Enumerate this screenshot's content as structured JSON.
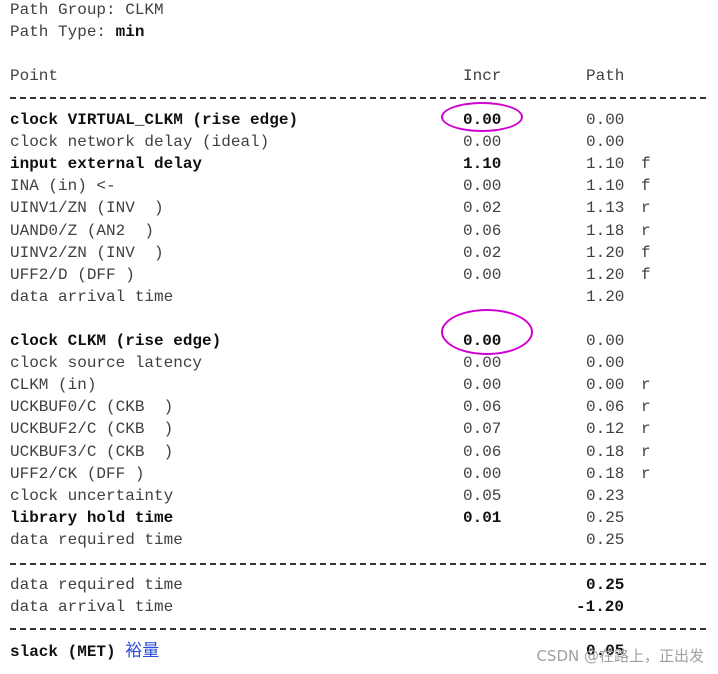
{
  "header": {
    "path_group": "Path Group: CLKM",
    "path_type_label": "Path Type: ",
    "path_type_value": "min"
  },
  "columns": {
    "point": "Point",
    "incr": "Incr",
    "path": "Path"
  },
  "launch_rows": [
    {
      "point": "clock VIRTUAL_CLKM (rise edge)",
      "incr": "0.00",
      "path": "0.00",
      "edge": "",
      "bold": true
    },
    {
      "point": "clock network delay (ideal)",
      "incr": "0.00",
      "path": "0.00",
      "edge": "",
      "bold": false
    },
    {
      "point": "input external delay",
      "incr": "1.10",
      "path": "1.10",
      "edge": "f",
      "bold": true
    },
    {
      "point": "INA (in) <-",
      "incr": "0.00",
      "path": "1.10",
      "edge": "f",
      "bold": false
    },
    {
      "point": "UINV1/ZN (INV  )",
      "incr": "0.02",
      "path": "1.13",
      "edge": "r",
      "bold": false
    },
    {
      "point": "UAND0/Z (AN2  )",
      "incr": "0.06",
      "path": "1.18",
      "edge": "r",
      "bold": false
    },
    {
      "point": "UINV2/ZN (INV  )",
      "incr": "0.02",
      "path": "1.20",
      "edge": "f",
      "bold": false
    },
    {
      "point": "UFF2/D (DFF )",
      "incr": "0.00",
      "path": "1.20",
      "edge": "f",
      "bold": false
    },
    {
      "point": "data arrival time",
      "incr": "",
      "path": "1.20",
      "edge": "",
      "bold": false
    }
  ],
  "capture_rows": [
    {
      "point": "clock CLKM (rise edge)",
      "incr": "0.00",
      "path": "0.00",
      "edge": "",
      "bold": true
    },
    {
      "point": "clock source latency",
      "incr": "0.00",
      "path": "0.00",
      "edge": "",
      "bold": false
    },
    {
      "point": "CLKM (in)",
      "incr": "0.00",
      "path": "0.00",
      "edge": "r",
      "bold": false
    },
    {
      "point": "UCKBUF0/C (CKB  )",
      "incr": "0.06",
      "path": "0.06",
      "edge": "r",
      "bold": false
    },
    {
      "point": "UCKBUF2/C (CKB  )",
      "incr": "0.07",
      "path": "0.12",
      "edge": "r",
      "bold": false
    },
    {
      "point": "UCKBUF3/C (CKB  )",
      "incr": "0.06",
      "path": "0.18",
      "edge": "r",
      "bold": false
    },
    {
      "point": "UFF2/CK (DFF )",
      "incr": "0.00",
      "path": "0.18",
      "edge": "r",
      "bold": false
    },
    {
      "point": "clock uncertainty",
      "incr": "0.05",
      "path": "0.23",
      "edge": "",
      "bold": false
    },
    {
      "point": "library hold time",
      "incr": "0.01",
      "path": "0.25",
      "edge": "",
      "bold": true
    },
    {
      "point": "data required time",
      "incr": "",
      "path": "0.25",
      "edge": "",
      "bold": false
    }
  ],
  "summary_rows": [
    {
      "point": "data required time",
      "path": "0.25"
    },
    {
      "point": "data arrival time",
      "path": "-1.20"
    }
  ],
  "slack": {
    "label": "slack (MET)",
    "annotation": "裕量",
    "value": "0.05"
  },
  "watermark": "CSDN @在路上，正出发",
  "colors": {
    "highlight_circle": "#d000d0",
    "annotation": "#2a4bd7"
  }
}
